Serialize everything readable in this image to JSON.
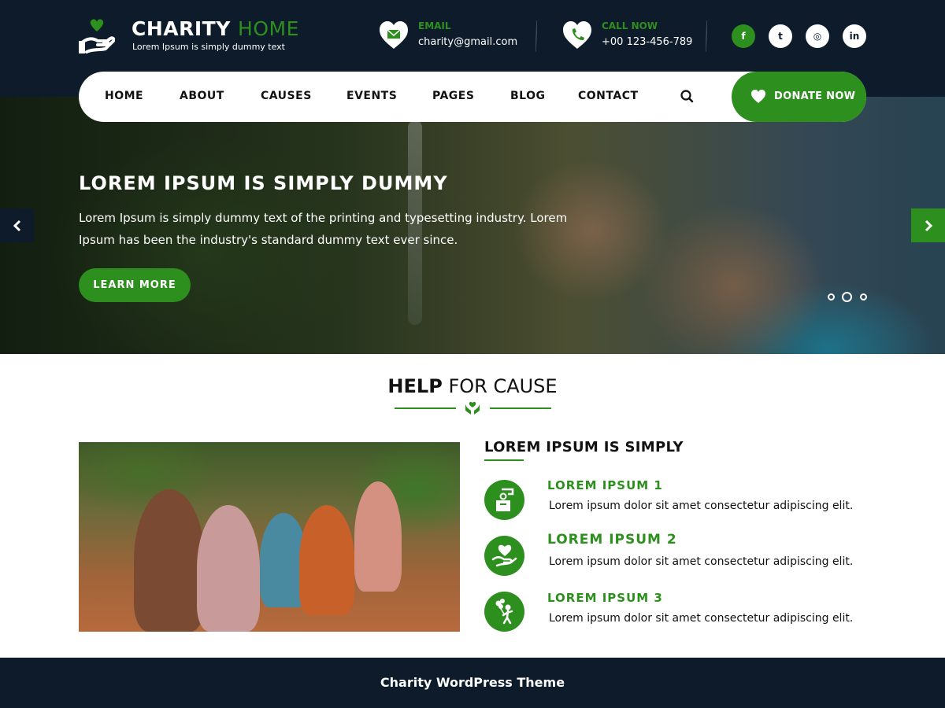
{
  "colors": {
    "accent": "#2d8f1e",
    "dark": "#0d1b2a",
    "white": "#ffffff"
  },
  "header": {
    "brand_main": "CHARITY",
    "brand_accent": "HOME",
    "tagline": "Lorem Ipsum is simply dummy text",
    "email": {
      "label": "EMAIL",
      "value": "charity@gmail.com",
      "icon": "envelope-heart-icon"
    },
    "phone": {
      "label": "CALL NOW",
      "value": "+00 123-456-789",
      "icon": "phone-heart-icon"
    },
    "social": [
      {
        "name": "facebook",
        "glyph": "f"
      },
      {
        "name": "twitter",
        "glyph": "t"
      },
      {
        "name": "instagram",
        "glyph": "◎"
      },
      {
        "name": "linkedin",
        "glyph": "in"
      }
    ]
  },
  "nav": {
    "items": [
      "HOME",
      "ABOUT",
      "CAUSES",
      "EVENTS",
      "PAGES",
      "BLOG",
      "CONTACT"
    ],
    "donate_label": "DONATE NOW"
  },
  "hero": {
    "title": "LOREM IPSUM IS SIMPLY DUMMY",
    "text": "Lorem Ipsum is simply dummy text of the printing and typesetting industry. Lorem Ipsum has been the industry's standard dummy text ever since.",
    "button": "LEARN MORE",
    "slides": 3,
    "active_slide": 2
  },
  "section": {
    "title_bold": "HELP",
    "title_rest": "FOR CAUSE",
    "column_title": "LOREM IPSUM IS SIMPLY",
    "features": [
      {
        "title": "LOREM IPSUM 1",
        "text": "Lorem ipsum dolor sit amet consectetur adipiscing elit.",
        "icon": "donation-box-icon"
      },
      {
        "title": "LOREM IPSUM 2",
        "text": "Lorem ipsum dolor sit amet consectetur adipiscing elit.",
        "icon": "heart-hand-icon"
      },
      {
        "title": "LOREM IPSUM 3",
        "text": "Lorem ipsum dolor sit amet consectetur adipiscing elit.",
        "icon": "child-balloons-icon"
      }
    ]
  },
  "footer": {
    "text": "Charity WordPress Theme"
  }
}
